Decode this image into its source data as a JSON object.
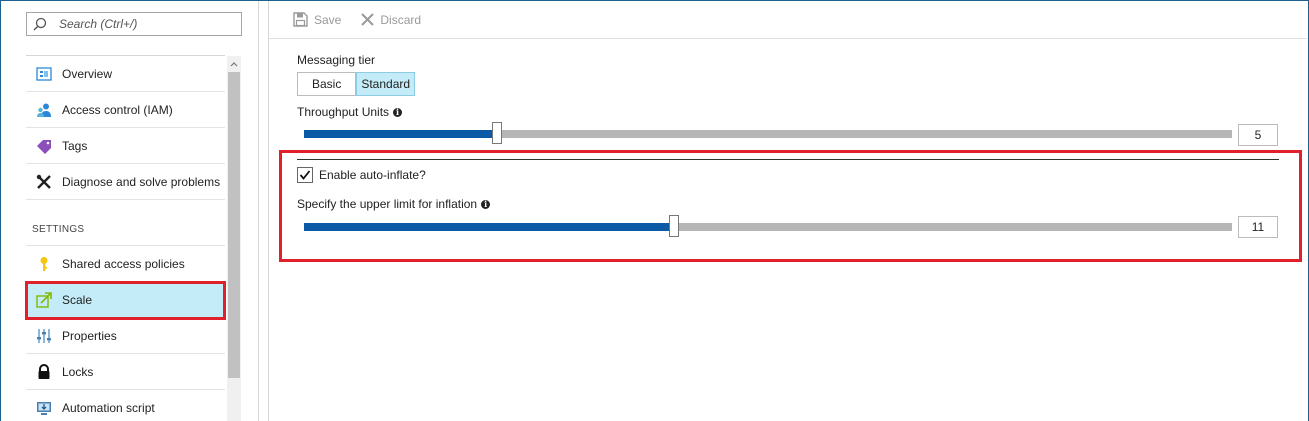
{
  "search": {
    "placeholder": "Search (Ctrl+/)"
  },
  "sidebar": {
    "items_top": [
      {
        "label": "Overview",
        "icon": "overview-icon"
      },
      {
        "label": "Access control (IAM)",
        "icon": "users-icon"
      },
      {
        "label": "Tags",
        "icon": "tag-icon"
      },
      {
        "label": "Diagnose and solve problems",
        "icon": "wrench-icon"
      }
    ],
    "section": "SETTINGS",
    "items_settings": [
      {
        "label": "Shared access policies",
        "icon": "key-icon"
      },
      {
        "label": "Scale",
        "icon": "scale-icon",
        "active": true
      },
      {
        "label": "Properties",
        "icon": "properties-icon"
      },
      {
        "label": "Locks",
        "icon": "lock-icon"
      },
      {
        "label": "Automation script",
        "icon": "automation-icon"
      }
    ]
  },
  "toolbar": {
    "save_label": "Save",
    "discard_label": "Discard"
  },
  "messaging_tier": {
    "label": "Messaging tier",
    "options": [
      "Basic",
      "Standard"
    ],
    "selected": "Standard"
  },
  "throughput": {
    "label": "Throughput Units",
    "value": "5",
    "level_fraction": 0.208
  },
  "auto_inflate": {
    "checkbox_label": "Enable auto-inflate?",
    "checked": true,
    "limit_label": "Specify the upper limit for inflation",
    "value": "11",
    "level_fraction": 0.399
  },
  "colors": {
    "accent_fill": "#0b5aa5",
    "selected_bg": "#c4ecf8",
    "highlight_border": "#e0202a"
  }
}
